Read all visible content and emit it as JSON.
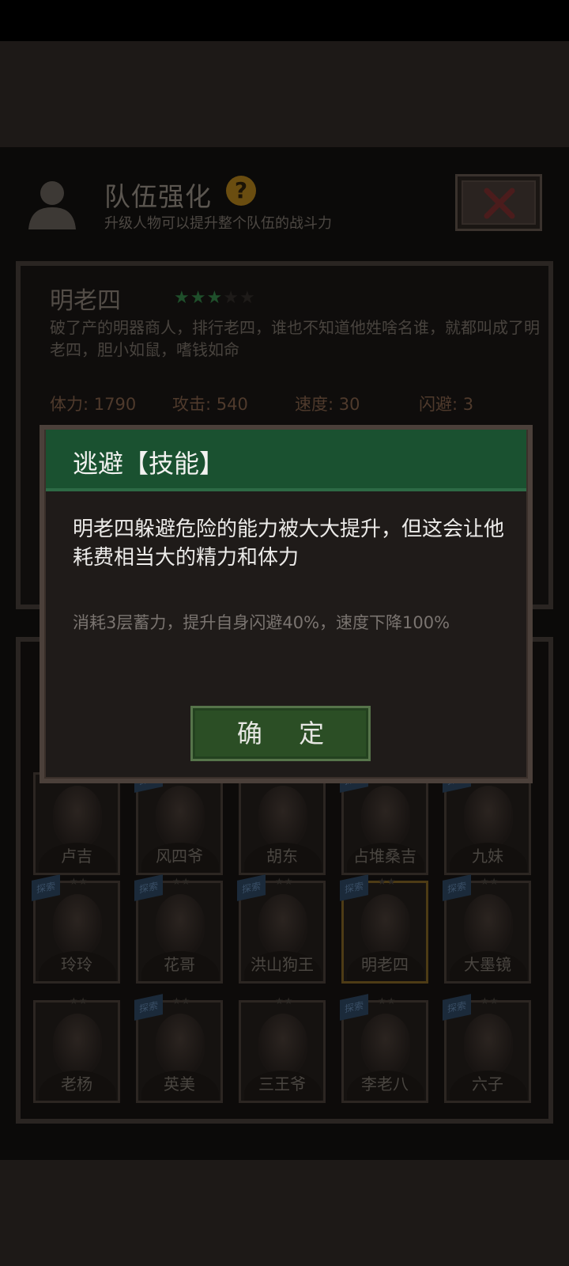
{
  "header": {
    "title": "队伍强化",
    "subtitle": "升级人物可以提升整个队伍的战斗力",
    "help_icon": "question-icon",
    "close_icon": "close-x-icon"
  },
  "character": {
    "name": "明老四",
    "stars_filled": 3,
    "stars_total": 5,
    "description": "破了产的明器商人，排行老四，谁也不知道他姓啥名谁，就都叫成了明老四，胆小如鼠，嗜钱如命",
    "stats": [
      {
        "label": "体力: 1790"
      },
      {
        "label": "攻击: 540"
      },
      {
        "label": "速度: 30"
      },
      {
        "label": "闪避: 3"
      }
    ]
  },
  "roster": {
    "rows": [
      [
        {
          "name": "卢吉",
          "tag": ""
        },
        {
          "name": "风四爷",
          "tag": "探索"
        },
        {
          "name": "胡东",
          "tag": ""
        },
        {
          "name": "占堆桑吉",
          "tag": "探索"
        },
        {
          "name": "九妹",
          "tag": "探索"
        }
      ],
      [
        {
          "name": "玲玲",
          "tag": "探索"
        },
        {
          "name": "花哥",
          "tag": "探索"
        },
        {
          "name": "洪山狗王",
          "tag": "探索"
        },
        {
          "name": "明老四",
          "tag": "探索",
          "selected": true
        },
        {
          "name": "大墨镜",
          "tag": "探索"
        }
      ],
      [
        {
          "name": "老杨",
          "tag": ""
        },
        {
          "name": "英美",
          "tag": "探索"
        },
        {
          "name": "三王爷",
          "tag": ""
        },
        {
          "name": "李老八",
          "tag": "探索"
        },
        {
          "name": "六子",
          "tag": "探索"
        }
      ]
    ]
  },
  "dialog": {
    "title": "逃避【技能】",
    "body": "明老四躲避危险的能力被大大提升，但这会让他耗费相当大的精力和体力",
    "detail": "消耗3层蓄力，提升自身闪避40%，速度下降100%",
    "confirm_label": "确 定"
  },
  "colors": {
    "dialog_header": "#1a5130",
    "confirm_button": "#2b4e25",
    "star_on": "#1f4f2b"
  }
}
